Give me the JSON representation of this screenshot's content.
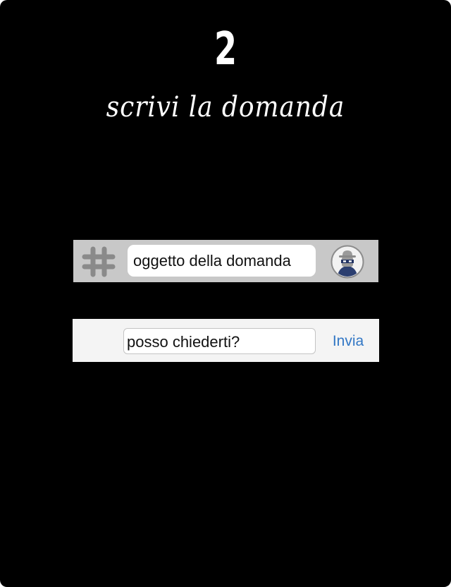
{
  "step": {
    "number": "2",
    "caption": "scrivi la domanda"
  },
  "topic_bar": {
    "icon": "hash-icon",
    "input_value": "oggetto della domanda",
    "avatar_icon": "incognito-avatar-icon",
    "background": "#c8c8c8"
  },
  "message_bar": {
    "input_value": "posso chiederti?",
    "send_label": "Invia",
    "accent": "#3277c5",
    "background": "#f4f4f4"
  },
  "colors": {
    "screen_background": "#000000",
    "text": "#ffffff"
  }
}
